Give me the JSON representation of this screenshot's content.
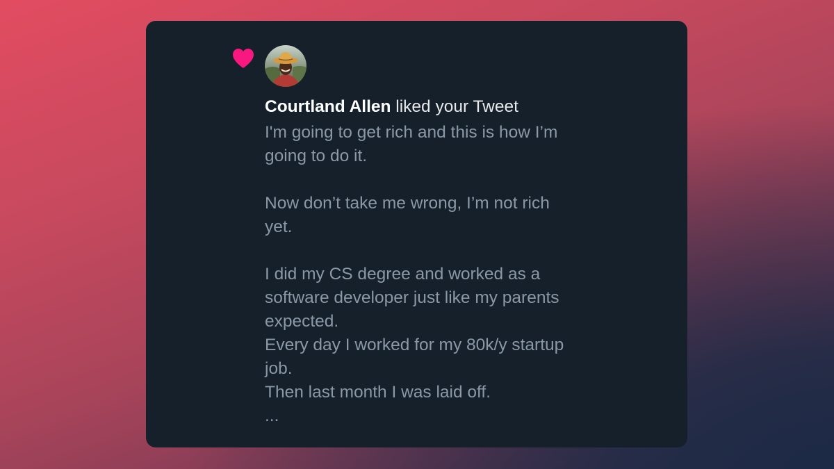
{
  "notification": {
    "icon": "heart-icon",
    "icon_color": "#f91880",
    "user_name": "Courtland Allen",
    "action_text": " liked your Tweet"
  },
  "tweet": {
    "lines": [
      "I'm going to get rich and this is how I’m",
      "going to do it.",
      "",
      "Now don’t take me wrong, I’m not rich",
      "yet.",
      "",
      "I did my CS degree and worked as a",
      "software developer just like my parents",
      "expected.",
      "Every day I worked for my 80k/y startup",
      "job.",
      "Then last month I was laid off.",
      "..."
    ]
  },
  "colors": {
    "card_background": "#15202b",
    "name_text": "#ffffff",
    "body_text": "#8b98a5"
  }
}
